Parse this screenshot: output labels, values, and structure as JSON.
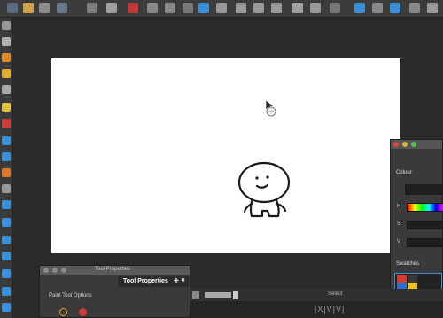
{
  "tool_properties": {
    "window_title": "Tool Properties",
    "tab_label": "Tool Properties",
    "pin_glyph": "✚",
    "close_glyph": "✖",
    "section_label": "Paint Tool Options"
  },
  "colour_panel": {
    "section_label": "Colour",
    "channels": [
      {
        "label": "H"
      },
      {
        "label": "S"
      },
      {
        "label": "V"
      }
    ],
    "swatches_label": "Swatches"
  },
  "status_bar": {
    "select_label": "Select"
  },
  "bottom_strip": {
    "tool_glyphs": "|X|V|V|"
  },
  "colors": {
    "accent_blue": "#3a8fd8",
    "canvas": "#ffffff",
    "swatch_red": "#d43c2c",
    "swatch_blue": "#2d6fd0",
    "swatch_yellow": "#f0c020"
  }
}
